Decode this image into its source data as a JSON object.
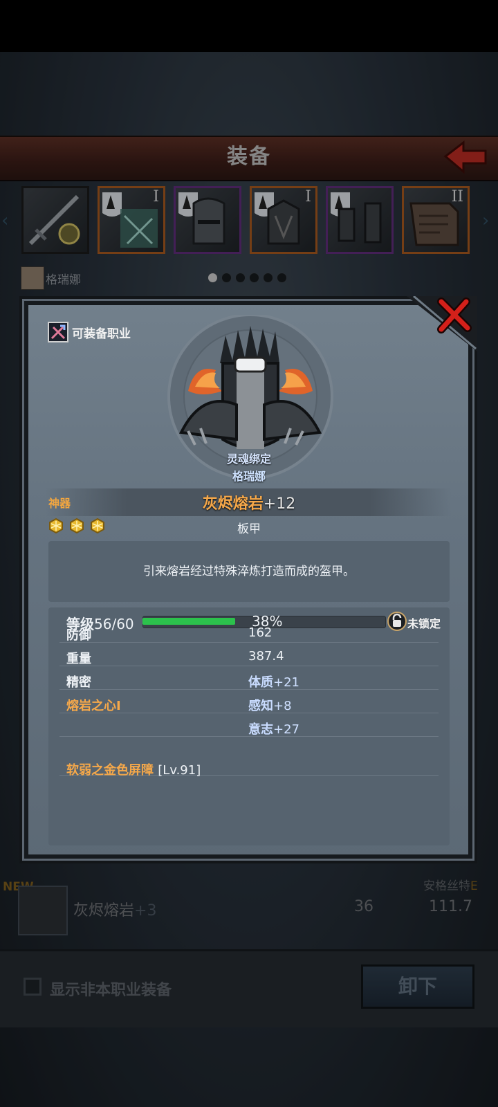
{
  "header": {
    "title": "装备"
  },
  "slots": [
    {
      "name": "weapon-slot",
      "roman": ""
    },
    {
      "name": "gloves-slot",
      "roman": "I"
    },
    {
      "name": "helmet-slot",
      "roman": ""
    },
    {
      "name": "armor-slot",
      "roman": "I"
    },
    {
      "name": "boots-slot",
      "roman": ""
    },
    {
      "name": "book-slot",
      "roman": "II"
    }
  ],
  "character": {
    "name": "格瑞娜"
  },
  "background_item": {
    "new_tag": "NEW",
    "name": "灰烬熔岩",
    "plus": "+3",
    "value1": "36",
    "value2": "111.7",
    "owner": "安格丝特",
    "owner_grade": "E"
  },
  "bottom_bar": {
    "checkbox_label": "显示非本职业装备",
    "unequip_label": "卸下"
  },
  "modal": {
    "class_label": "可装备职业",
    "soulbound_label": "灵魂绑定",
    "soulbound_owner": "格瑞娜",
    "rarity": "神器",
    "item_name": "灰烬熔岩",
    "enhance": "+12",
    "item_type": "板甲",
    "stars": 3,
    "description": "引来熔岩经过特殊淬炼打造而成的盔甲。",
    "level_label": "等级",
    "level_value": "56/60",
    "exp_percent": "38%",
    "exp_fill_fraction": 0.38,
    "lock_label": "未锁定",
    "stats": {
      "defense_label": "防御",
      "defense_value": "162",
      "weight_label": "重量",
      "weight_value": "387.4",
      "precision_label": "精密",
      "precision_bonus_name": "体质",
      "precision_bonus_value": "+21",
      "lava_heart_label": "熔岩之心Ⅰ",
      "lava_bonus_name": "感知",
      "lava_bonus_value": "+8",
      "extra_bonus_name": "意志",
      "extra_bonus_value": "+27"
    },
    "skill_name": "软弱之金色屏障",
    "skill_level": "[Lv.91]"
  },
  "colors": {
    "rarity_orange": "#f5a84a",
    "exp_green": "#2cc14c",
    "close_red": "#d4201a",
    "bonus_blue": "#c9dcff"
  }
}
